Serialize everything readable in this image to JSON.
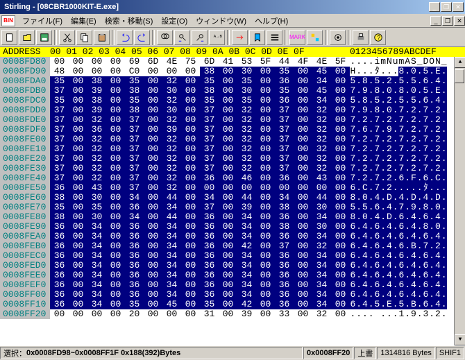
{
  "title_app": "Stirling",
  "title_file": "[08CBR1000KIT-E.exe]",
  "menus": [
    "ファイル(F)",
    "編集(E)",
    "検索・移動(S)",
    "設定(O)",
    "ウィンドウ(W)",
    "ヘルプ(H)"
  ],
  "bin_icon": "BIN",
  "header": {
    "addr": "ADDRESS",
    "bytes": "00 01 02 03 04 05 06 07 08 09 0A 0B 0C 0D 0E 0F",
    "ascii": "0123456789ABCDEF"
  },
  "sel_start": 7,
  "rows": [
    {
      "a": "0008FD80",
      "h": [
        "00",
        "00",
        "00",
        "00",
        "69",
        "6D",
        "4E",
        "75",
        "6D",
        "41",
        "53",
        "5F",
        "44",
        "4F",
        "4E",
        "5F"
      ],
      "s": [
        0,
        0,
        0,
        0,
        0,
        0,
        0,
        0,
        0,
        0,
        0,
        0,
        0,
        0,
        0,
        0
      ],
      "t": "....imNumAS_DON_"
    },
    {
      "a": "0008FD90",
      "h": [
        "48",
        "00",
        "00",
        "00",
        "C0",
        "00",
        "00",
        "00",
        "38",
        "00",
        "30",
        "00",
        "35",
        "00",
        "45",
        "00"
      ],
      "s": [
        0,
        0,
        0,
        0,
        0,
        0,
        0,
        0,
        1,
        1,
        1,
        1,
        1,
        1,
        1,
        1
      ],
      "t": "H...ﾀ...8.0.5.E."
    },
    {
      "a": "0008FDA0",
      "h": [
        "35",
        "00",
        "38",
        "00",
        "35",
        "00",
        "32",
        "00",
        "35",
        "00",
        "35",
        "00",
        "36",
        "00",
        "34",
        "00"
      ],
      "s": [
        1,
        1,
        1,
        1,
        1,
        1,
        1,
        1,
        1,
        1,
        1,
        1,
        1,
        1,
        1,
        1
      ],
      "t": "5.8.5.2.5.5.6.4."
    },
    {
      "a": "0008FDB0",
      "h": [
        "37",
        "00",
        "39",
        "00",
        "38",
        "00",
        "30",
        "00",
        "38",
        "00",
        "30",
        "00",
        "35",
        "00",
        "45",
        "00"
      ],
      "s": [
        1,
        1,
        1,
        1,
        1,
        1,
        1,
        1,
        1,
        1,
        1,
        1,
        1,
        1,
        1,
        1
      ],
      "t": "7.9.8.0.8.0.5.E."
    },
    {
      "a": "0008FDC0",
      "h": [
        "35",
        "00",
        "38",
        "00",
        "35",
        "00",
        "32",
        "00",
        "35",
        "00",
        "35",
        "00",
        "36",
        "00",
        "34",
        "00"
      ],
      "s": [
        1,
        1,
        1,
        1,
        1,
        1,
        1,
        1,
        1,
        1,
        1,
        1,
        1,
        1,
        1,
        1
      ],
      "t": "5.8.5.2.5.5.6.4."
    },
    {
      "a": "0008FDD0",
      "h": [
        "37",
        "00",
        "39",
        "00",
        "38",
        "00",
        "30",
        "00",
        "37",
        "00",
        "32",
        "00",
        "37",
        "00",
        "32",
        "00"
      ],
      "s": [
        1,
        1,
        1,
        1,
        1,
        1,
        1,
        1,
        1,
        1,
        1,
        1,
        1,
        1,
        1,
        1
      ],
      "t": "7.9.8.0.7.2.7.2."
    },
    {
      "a": "0008FDE0",
      "h": [
        "37",
        "00",
        "32",
        "00",
        "37",
        "00",
        "32",
        "00",
        "37",
        "00",
        "32",
        "00",
        "37",
        "00",
        "32",
        "00"
      ],
      "s": [
        1,
        1,
        1,
        1,
        1,
        1,
        1,
        1,
        1,
        1,
        1,
        1,
        1,
        1,
        1,
        1
      ],
      "t": "7.2.7.2.7.2.7.2."
    },
    {
      "a": "0008FDF0",
      "h": [
        "37",
        "00",
        "36",
        "00",
        "37",
        "00",
        "39",
        "00",
        "37",
        "00",
        "32",
        "00",
        "37",
        "00",
        "32",
        "00"
      ],
      "s": [
        1,
        1,
        1,
        1,
        1,
        1,
        1,
        1,
        1,
        1,
        1,
        1,
        1,
        1,
        1,
        1
      ],
      "t": "7.6.7.9.7.2.7.2."
    },
    {
      "a": "0008FE00",
      "h": [
        "37",
        "00",
        "32",
        "00",
        "37",
        "00",
        "32",
        "00",
        "37",
        "00",
        "32",
        "00",
        "37",
        "00",
        "32",
        "00"
      ],
      "s": [
        1,
        1,
        1,
        1,
        1,
        1,
        1,
        1,
        1,
        1,
        1,
        1,
        1,
        1,
        1,
        1
      ],
      "t": "7.2.7.2.7.2.7.2."
    },
    {
      "a": "0008FE10",
      "h": [
        "37",
        "00",
        "32",
        "00",
        "37",
        "00",
        "32",
        "00",
        "37",
        "00",
        "32",
        "00",
        "37",
        "00",
        "32",
        "00"
      ],
      "s": [
        1,
        1,
        1,
        1,
        1,
        1,
        1,
        1,
        1,
        1,
        1,
        1,
        1,
        1,
        1,
        1
      ],
      "t": "7.2.7.2.7.2.7.2."
    },
    {
      "a": "0008FE20",
      "h": [
        "37",
        "00",
        "32",
        "00",
        "37",
        "00",
        "32",
        "00",
        "37",
        "00",
        "32",
        "00",
        "37",
        "00",
        "32",
        "00"
      ],
      "s": [
        1,
        1,
        1,
        1,
        1,
        1,
        1,
        1,
        1,
        1,
        1,
        1,
        1,
        1,
        1,
        1
      ],
      "t": "7.2.7.2.7.2.7.2."
    },
    {
      "a": "0008FE30",
      "h": [
        "37",
        "00",
        "32",
        "00",
        "37",
        "00",
        "32",
        "00",
        "37",
        "00",
        "32",
        "00",
        "37",
        "00",
        "32",
        "00"
      ],
      "s": [
        1,
        1,
        1,
        1,
        1,
        1,
        1,
        1,
        1,
        1,
        1,
        1,
        1,
        1,
        1,
        1
      ],
      "t": "7.2.7.2.7.2.7.2."
    },
    {
      "a": "0008FE40",
      "h": [
        "37",
        "00",
        "32",
        "00",
        "37",
        "00",
        "32",
        "00",
        "36",
        "00",
        "46",
        "00",
        "36",
        "00",
        "43",
        "00"
      ],
      "s": [
        1,
        1,
        1,
        1,
        1,
        1,
        1,
        1,
        1,
        1,
        1,
        1,
        1,
        1,
        1,
        1
      ],
      "t": "7.2.7.2.6.F.6.C."
    },
    {
      "a": "0008FE50",
      "h": [
        "36",
        "00",
        "43",
        "00",
        "37",
        "00",
        "32",
        "00",
        "00",
        "00",
        "00",
        "00",
        "00",
        "00",
        "00",
        "00"
      ],
      "s": [
        1,
        1,
        1,
        1,
        1,
        1,
        1,
        1,
        1,
        1,
        1,
        1,
        1,
        1,
        1,
        1
      ],
      "t": "6.C.7.2.....ﾀ..."
    },
    {
      "a": "0008FE60",
      "h": [
        "38",
        "00",
        "30",
        "00",
        "34",
        "00",
        "44",
        "00",
        "34",
        "00",
        "44",
        "00",
        "34",
        "00",
        "44",
        "00"
      ],
      "s": [
        1,
        1,
        1,
        1,
        1,
        1,
        1,
        1,
        1,
        1,
        1,
        1,
        1,
        1,
        1,
        1
      ],
      "t": "8.0.4.D.4.D.4.D."
    },
    {
      "a": "0008FE70",
      "h": [
        "35",
        "00",
        "35",
        "00",
        "36",
        "00",
        "34",
        "00",
        "37",
        "00",
        "39",
        "00",
        "38",
        "00",
        "30",
        "00"
      ],
      "s": [
        1,
        1,
        1,
        1,
        1,
        1,
        1,
        1,
        1,
        1,
        1,
        1,
        1,
        1,
        1,
        1
      ],
      "t": "5.5.6.4.7.9.8.0."
    },
    {
      "a": "0008FE80",
      "h": [
        "38",
        "00",
        "30",
        "00",
        "34",
        "00",
        "44",
        "00",
        "36",
        "00",
        "34",
        "00",
        "36",
        "00",
        "34",
        "00"
      ],
      "s": [
        1,
        1,
        1,
        1,
        1,
        1,
        1,
        1,
        1,
        1,
        1,
        1,
        1,
        1,
        1,
        1
      ],
      "t": "8.0.4.D.6.4.6.4."
    },
    {
      "a": "0008FE90",
      "h": [
        "36",
        "00",
        "34",
        "00",
        "36",
        "00",
        "34",
        "00",
        "36",
        "00",
        "34",
        "00",
        "38",
        "00",
        "30",
        "00"
      ],
      "s": [
        1,
        1,
        1,
        1,
        1,
        1,
        1,
        1,
        1,
        1,
        1,
        1,
        1,
        1,
        1,
        1
      ],
      "t": "6.4.6.4.6.4.8.0."
    },
    {
      "a": "0008FEA0",
      "h": [
        "36",
        "00",
        "34",
        "00",
        "36",
        "00",
        "34",
        "00",
        "36",
        "00",
        "34",
        "00",
        "36",
        "00",
        "34",
        "00"
      ],
      "s": [
        1,
        1,
        1,
        1,
        1,
        1,
        1,
        1,
        1,
        1,
        1,
        1,
        1,
        1,
        1,
        1
      ],
      "t": "6.4.6.4.6.4.6.4."
    },
    {
      "a": "0008FEB0",
      "h": [
        "36",
        "00",
        "34",
        "00",
        "36",
        "00",
        "34",
        "00",
        "36",
        "00",
        "42",
        "00",
        "37",
        "00",
        "32",
        "00"
      ],
      "s": [
        1,
        1,
        1,
        1,
        1,
        1,
        1,
        1,
        1,
        1,
        1,
        1,
        1,
        1,
        1,
        1
      ],
      "t": "6.4.6.4.6.B.7.2."
    },
    {
      "a": "0008FEC0",
      "h": [
        "36",
        "00",
        "34",
        "00",
        "36",
        "00",
        "34",
        "00",
        "36",
        "00",
        "34",
        "00",
        "36",
        "00",
        "34",
        "00"
      ],
      "s": [
        1,
        1,
        1,
        1,
        1,
        1,
        1,
        1,
        1,
        1,
        1,
        1,
        1,
        1,
        1,
        1
      ],
      "t": "6.4.6.4.6.4.6.4."
    },
    {
      "a": "0008FED0",
      "h": [
        "36",
        "00",
        "34",
        "00",
        "36",
        "00",
        "34",
        "00",
        "36",
        "00",
        "34",
        "00",
        "36",
        "00",
        "34",
        "00"
      ],
      "s": [
        1,
        1,
        1,
        1,
        1,
        1,
        1,
        1,
        1,
        1,
        1,
        1,
        1,
        1,
        1,
        1
      ],
      "t": "6.4.6.4.6.4.6.4."
    },
    {
      "a": "0008FEE0",
      "h": [
        "36",
        "00",
        "34",
        "00",
        "36",
        "00",
        "34",
        "00",
        "36",
        "00",
        "34",
        "00",
        "36",
        "00",
        "34",
        "00"
      ],
      "s": [
        1,
        1,
        1,
        1,
        1,
        1,
        1,
        1,
        1,
        1,
        1,
        1,
        1,
        1,
        1,
        1
      ],
      "t": "6.4.6.4.6.4.6.4."
    },
    {
      "a": "0008FEF0",
      "h": [
        "36",
        "00",
        "34",
        "00",
        "36",
        "00",
        "34",
        "00",
        "36",
        "00",
        "34",
        "00",
        "36",
        "00",
        "34",
        "00"
      ],
      "s": [
        1,
        1,
        1,
        1,
        1,
        1,
        1,
        1,
        1,
        1,
        1,
        1,
        1,
        1,
        1,
        1
      ],
      "t": "6.4.6.4.6.4.6.4."
    },
    {
      "a": "0008FF00",
      "h": [
        "36",
        "00",
        "34",
        "00",
        "36",
        "00",
        "34",
        "00",
        "36",
        "00",
        "34",
        "00",
        "36",
        "00",
        "34",
        "00"
      ],
      "s": [
        1,
        1,
        1,
        1,
        1,
        1,
        1,
        1,
        1,
        1,
        1,
        1,
        1,
        1,
        1,
        1
      ],
      "t": "6.4.6.4.6.4.6.4."
    },
    {
      "a": "0008FF10",
      "h": [
        "36",
        "00",
        "34",
        "00",
        "35",
        "00",
        "45",
        "00",
        "35",
        "00",
        "42",
        "00",
        "36",
        "00",
        "34",
        "00"
      ],
      "s": [
        1,
        1,
        1,
        1,
        1,
        1,
        1,
        1,
        1,
        1,
        1,
        1,
        1,
        1,
        1,
        1
      ],
      "t": "6.4.5.E.5.B.6.4."
    },
    {
      "a": "0008FF20",
      "h": [
        "00",
        "00",
        "00",
        "00",
        "20",
        "00",
        "00",
        "00",
        "31",
        "00",
        "39",
        "00",
        "33",
        "00",
        "32",
        "00"
      ],
      "s": [
        0,
        0,
        0,
        0,
        0,
        0,
        0,
        0,
        0,
        0,
        0,
        0,
        0,
        0,
        0,
        0
      ],
      "t": ".... ...1.9.3.2."
    }
  ],
  "status": {
    "selection_label": "選択：",
    "selection": "0x0008FD98~0x0008FF1F 0x188(392)Bytes",
    "cursor": "0x0008FF20",
    "mode": "上書",
    "size": "1314816 Bytes",
    "shift": "SHIF1"
  }
}
